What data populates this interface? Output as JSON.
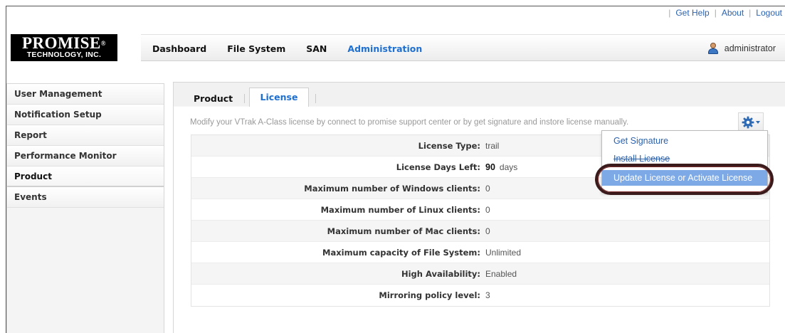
{
  "top_links": [
    {
      "label": "Get Help"
    },
    {
      "label": "About"
    },
    {
      "label": "Logout"
    }
  ],
  "logo": {
    "line1": "PROMISE",
    "mark": "®",
    "line2": "TECHNOLOGY, INC."
  },
  "nav": {
    "items": [
      {
        "label": "Dashboard"
      },
      {
        "label": "File System"
      },
      {
        "label": "SAN"
      },
      {
        "label": "Administration",
        "active": true
      }
    ],
    "user": "administrator",
    "user_icon": "user-icon"
  },
  "sidebar": {
    "items": [
      {
        "label": "User Management"
      },
      {
        "label": "Notification Setup"
      },
      {
        "label": "Report"
      },
      {
        "label": "Performance Monitor"
      },
      {
        "label": "Product",
        "active": true
      },
      {
        "label": "Events"
      }
    ]
  },
  "tabs": [
    {
      "label": "Product"
    },
    {
      "label": "License",
      "active": true
    }
  ],
  "license": {
    "description": "Modify your VTrak A-Class license by connect to promise support center or by get signature and instore license manually.",
    "rows": [
      {
        "label": "License Type:",
        "value": "trail"
      },
      {
        "label": "License Days Left:",
        "value": "90",
        "unit": "days"
      },
      {
        "label": "Maximum number of Windows clients:",
        "value": "0"
      },
      {
        "label": "Maximum number of Linux clients:",
        "value": "0"
      },
      {
        "label": "Maximum number of Mac clients:",
        "value": "0"
      },
      {
        "label": "Maximum capacity of File System:",
        "value": "Unlimited"
      },
      {
        "label": "High Availability:",
        "value": "Enabled"
      },
      {
        "label": "Mirroring policy level:",
        "value": "3"
      }
    ]
  },
  "actions_menu": {
    "icon": "gear-icon",
    "items": [
      {
        "label": "Get Signature"
      },
      {
        "label": "Install License"
      },
      {
        "label": "Update License or Activate License",
        "highlighted": true
      }
    ]
  },
  "colors": {
    "accent": "#1e6fd0",
    "link": "#2a62b0",
    "highlight_bg": "#7da9e6",
    "ring": "#3a1a1a"
  }
}
